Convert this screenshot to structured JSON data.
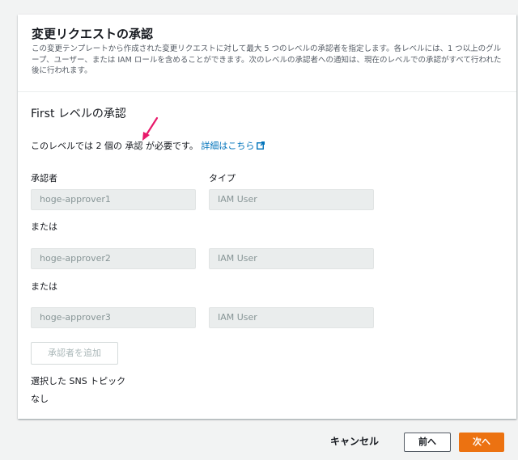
{
  "header": {
    "title": "変更リクエストの承認",
    "description": "この変更テンプレートから作成された変更リクエストに対して最大 5 つのレベルの承認者を指定します。各レベルには、1 つ以上のグループ、ユーザー、または IAM ロールを含めることができます。次のレベルの承認者への通知は、現在のレベルでの承認がすべて行われた後に行われます。"
  },
  "level": {
    "title": "First レベルの承認",
    "description": "このレベルでは 2 個の 承認 が必要です。",
    "link_label": "詳細はこちら"
  },
  "columns": {
    "approver": "承認者",
    "type": "タイプ"
  },
  "approvers": [
    {
      "name": "hoge-approver1",
      "type": "IAM User"
    },
    {
      "name": "hoge-approver2",
      "type": "IAM User"
    },
    {
      "name": "hoge-approver3",
      "type": "IAM User"
    }
  ],
  "or_label": "または",
  "add_approver_label": "承認者を追加",
  "sns": {
    "label": "選択した SNS トピック",
    "value": "なし"
  },
  "footer": {
    "cancel": "キャンセル",
    "prev": "前へ",
    "next": "次へ"
  },
  "colors": {
    "accent": "#ec7211",
    "link": "#0073bb",
    "annotation_arrow": "#e8196a"
  }
}
